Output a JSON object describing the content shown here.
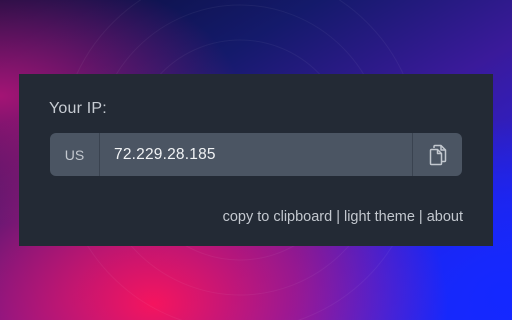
{
  "popup": {
    "title": "Your IP:",
    "country": "US",
    "ip": "72.229.28.185",
    "copy_icon": "copy-icon"
  },
  "links": {
    "copy": "copy to clipboard",
    "theme": "light theme",
    "about": "about",
    "separator": "|"
  },
  "colors": {
    "panel": "#232a35",
    "field": "#4b5563",
    "text": "#c3c8cf"
  }
}
